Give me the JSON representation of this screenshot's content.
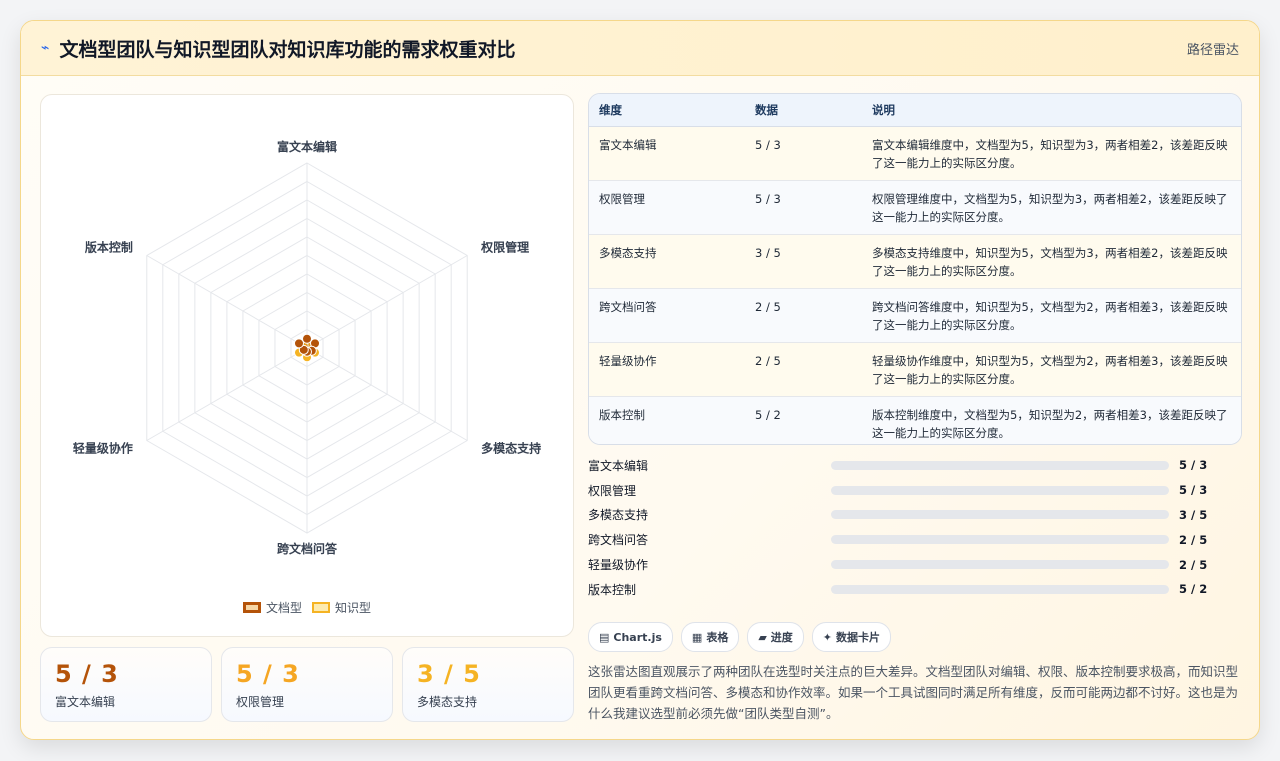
{
  "header": {
    "icon": "pulse-icon",
    "title": "文档型团队与知识型团队对知识库功能的需求权重对比",
    "chart_type_label": "路径雷达"
  },
  "chart_data": {
    "type": "radar",
    "axes": [
      "富文本编辑",
      "权限管理",
      "多模态支持",
      "跨文档问答",
      "轻量级协作",
      "版本控制"
    ],
    "scale_max": 100,
    "series": [
      {
        "name": "文档型",
        "values": [
          5,
          5,
          3,
          2,
          2,
          5
        ],
        "color": "#b45309"
      },
      {
        "name": "知识型",
        "values": [
          3,
          3,
          5,
          5,
          5,
          2
        ],
        "color": "#f5b323"
      }
    ]
  },
  "stats": [
    {
      "value": "5 / 3",
      "label": "富文本编辑",
      "color": "#b45309"
    },
    {
      "value": "5 / 3",
      "label": "权限管理",
      "color": "#f5a623"
    },
    {
      "value": "3 / 5",
      "label": "多模态支持",
      "color": "#f5b323"
    }
  ],
  "table": {
    "headers": [
      "维度",
      "数据",
      "说明"
    ],
    "rows": [
      {
        "dim": "富文本编辑",
        "data": "5 / 3",
        "note": "富文本编辑维度中，文档型为5，知识型为3，两者相差2，该差距反映了这一能力上的实际区分度。"
      },
      {
        "dim": "权限管理",
        "data": "5 / 3",
        "note": "权限管理维度中，文档型为5，知识型为3，两者相差2，该差距反映了这一能力上的实际区分度。"
      },
      {
        "dim": "多模态支持",
        "data": "3 / 5",
        "note": "多模态支持维度中，知识型为5，文档型为3，两者相差2，该差距反映了这一能力上的实际区分度。"
      },
      {
        "dim": "跨文档问答",
        "data": "2 / 5",
        "note": "跨文档问答维度中，知识型为5，文档型为2，两者相差3，该差距反映了这一能力上的实际区分度。"
      },
      {
        "dim": "轻量级协作",
        "data": "2 / 5",
        "note": "轻量级协作维度中，知识型为5，文档型为2，两者相差3，该差距反映了这一能力上的实际区分度。"
      },
      {
        "dim": "版本控制",
        "data": "5 / 2",
        "note": "版本控制维度中，文档型为5，知识型为2，两者相差3，该差距反映了这一能力上的实际区分度。"
      }
    ]
  },
  "bars": [
    {
      "label": "富文本编辑",
      "value": "5 / 3",
      "fill_fraction": 0.06
    },
    {
      "label": "权限管理",
      "value": "5 / 3",
      "fill_fraction": 0.06
    },
    {
      "label": "多模态支持",
      "value": "3 / 5",
      "fill_fraction": 0.06
    },
    {
      "label": "跨文档问答",
      "value": "2 / 5",
      "fill_fraction": 0.06
    },
    {
      "label": "轻量级协作",
      "value": "2 / 5",
      "fill_fraction": 0.06
    },
    {
      "label": "版本控制",
      "value": "5 / 2",
      "fill_fraction": 0.06
    }
  ],
  "chips": [
    {
      "icon": "chart-icon",
      "glyph": "▤",
      "label": "Chart.js"
    },
    {
      "icon": "table-icon",
      "glyph": "▦",
      "label": "表格"
    },
    {
      "icon": "progress-icon",
      "glyph": "▰",
      "label": "进度"
    },
    {
      "icon": "card-icon",
      "glyph": "✦",
      "label": "数据卡片"
    }
  ],
  "description": "这张雷达图直观展示了两种团队在选型时关注点的巨大差异。文档型团队对编辑、权限、版本控制要求极高，而知识型团队更看重跨文档问答、多模态和协作效率。如果一个工具试图同时满足所有维度，反而可能两边都不讨好。这也是为什么我建议选型前必须先做“团队类型自测”。"
}
